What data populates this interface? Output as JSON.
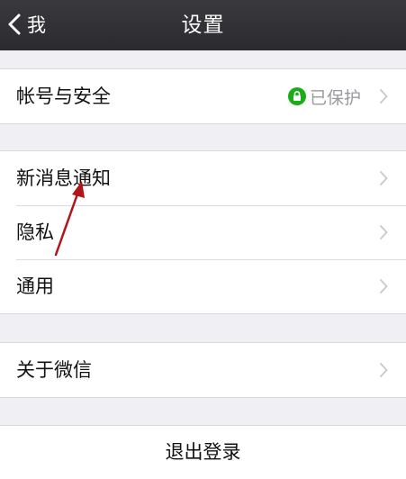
{
  "navbar": {
    "back_label": "我",
    "title": "设置"
  },
  "groups": [
    {
      "items": [
        {
          "label": "帐号与安全",
          "status": "已保护",
          "status_icon": "lock-icon",
          "status_color": "#1aad19"
        }
      ]
    },
    {
      "items": [
        {
          "label": "新消息通知"
        },
        {
          "label": "隐私"
        },
        {
          "label": "通用"
        }
      ]
    },
    {
      "items": [
        {
          "label": "关于微信"
        }
      ]
    }
  ],
  "logout": {
    "label": "退出登录"
  },
  "annotation": {
    "arrow_color": "#b0151b"
  }
}
